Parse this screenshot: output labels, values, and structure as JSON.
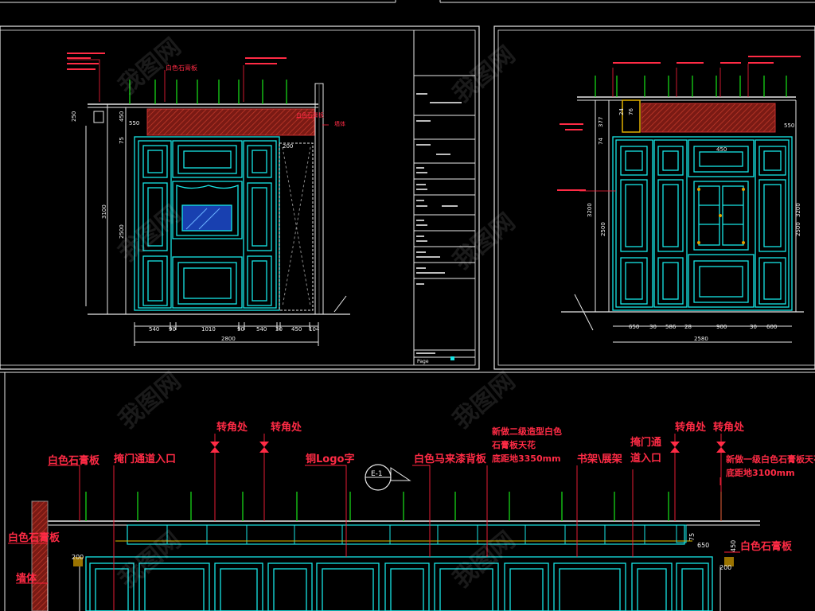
{
  "top_left": {
    "labels": {
      "gypsum_board": "白色石膏板",
      "wall": "墙体"
    },
    "dims_bottom": [
      "540",
      "90",
      "1010",
      "90",
      "540",
      "30",
      "450",
      "104"
    ],
    "dim_total": "2800",
    "dims_left": [
      "250",
      "450",
      "75",
      "3100",
      "2500"
    ],
    "dim_small": [
      "550",
      "200"
    ]
  },
  "top_right": {
    "dims_bottom": [
      "650",
      "30",
      "586",
      "28",
      "900",
      "30",
      "600"
    ],
    "dim_total": "2580",
    "dims_left": [
      "377",
      "74",
      "3200",
      "2500"
    ],
    "dims_top": [
      "24",
      "76",
      "450",
      "550"
    ]
  },
  "title_block": {
    "last_label": "Page"
  },
  "bottom": {
    "labels": {
      "corner_1": "转角处",
      "corner_2": "转角处",
      "corner_3": "转角处",
      "corner_4": "转角处",
      "white_gypsum": "白色石膏板",
      "passage_entrance": "掩门通道入口",
      "copper_logo": "铜Logo字",
      "marble_back": "白色马来漆背板",
      "new_ceiling_1": "新做二级造型白色",
      "new_ceiling_2": "石膏板天花",
      "new_ceiling_3": "底距地3350mm",
      "bookshelf": "书架\\展架",
      "passage_2a": "掩门通",
      "passage_2b": "道入口",
      "new_level_1": "新做一级白色石膏板天花",
      "new_level_2": "底距地3100mm",
      "white_gypsum_left": "白色石膏板",
      "wall": "墙体",
      "white_gypsum_right": "白色石膏板",
      "section_mark": "E-1"
    },
    "dims": [
      "200",
      "650",
      "200",
      "75",
      "450"
    ]
  },
  "watermark": "我图网"
}
